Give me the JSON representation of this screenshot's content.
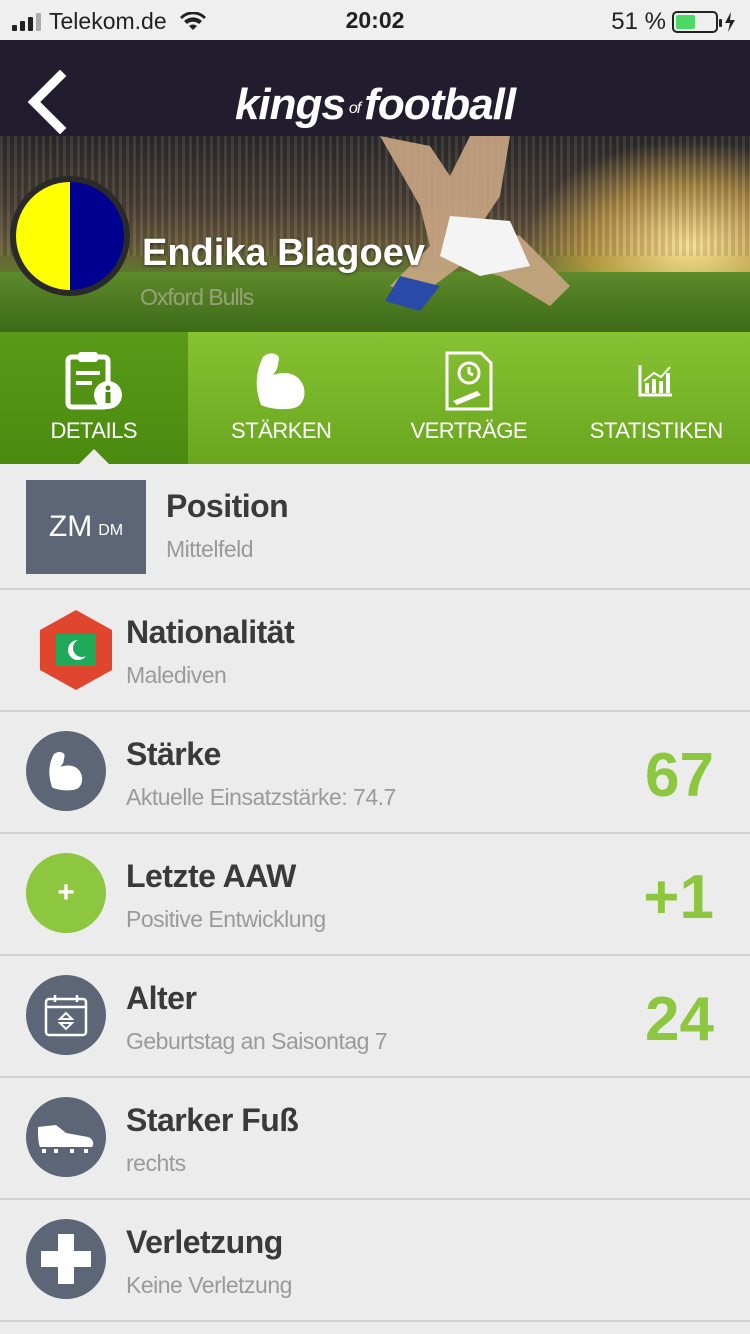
{
  "status_bar": {
    "carrier": "Telekom.de",
    "time": "20:02",
    "battery_percent": "51 %",
    "battery_level": 0.51
  },
  "header": {
    "logo_main_1": "kings",
    "logo_of": "of",
    "logo_main_2": "football"
  },
  "player": {
    "name": "Endika Blagoev",
    "club": "Oxford Bulls",
    "club_colors": [
      "#ffff00",
      "#000090"
    ]
  },
  "tabs": [
    {
      "label": "DETAILS",
      "icon": "details-info-icon",
      "active": true
    },
    {
      "label": "STÄRKEN",
      "icon": "flexed-arm-icon",
      "active": false
    },
    {
      "label": "VERTRÄGE",
      "icon": "contract-icon",
      "active": false
    },
    {
      "label": "STATISTIKEN",
      "icon": "bar-chart-icon",
      "active": false
    }
  ],
  "details": {
    "position": {
      "title": "Position",
      "subtitle": "Mittelfeld",
      "primary": "ZM",
      "secondary": "DM"
    },
    "nationality": {
      "title": "Nationalität",
      "subtitle": "Malediven",
      "flag_icon": "maldives-flag-icon"
    },
    "strength": {
      "title": "Stärke",
      "subtitle": "Aktuelle Einsatzstärke: 74.7",
      "value": "67",
      "icon": "flexed-arm-icon"
    },
    "last_aaw": {
      "title": "Letzte AAW",
      "subtitle": "Positive Entwicklung",
      "value": "+1",
      "icon_glyph": "+"
    },
    "age": {
      "title": "Alter",
      "subtitle": "Geburtstag an Saisontag 7",
      "value": "24",
      "icon": "calendar-icon"
    },
    "foot": {
      "title": "Starker Fuß",
      "subtitle": "rechts",
      "icon": "football-boot-icon"
    },
    "injury": {
      "title": "Verletzung",
      "subtitle": "Keine Verletzung",
      "icon": "medical-cross-icon"
    }
  },
  "colors": {
    "accent_green": "#8dc63f",
    "header_bg": "#221d2e",
    "icon_bg": "#5c6677"
  }
}
